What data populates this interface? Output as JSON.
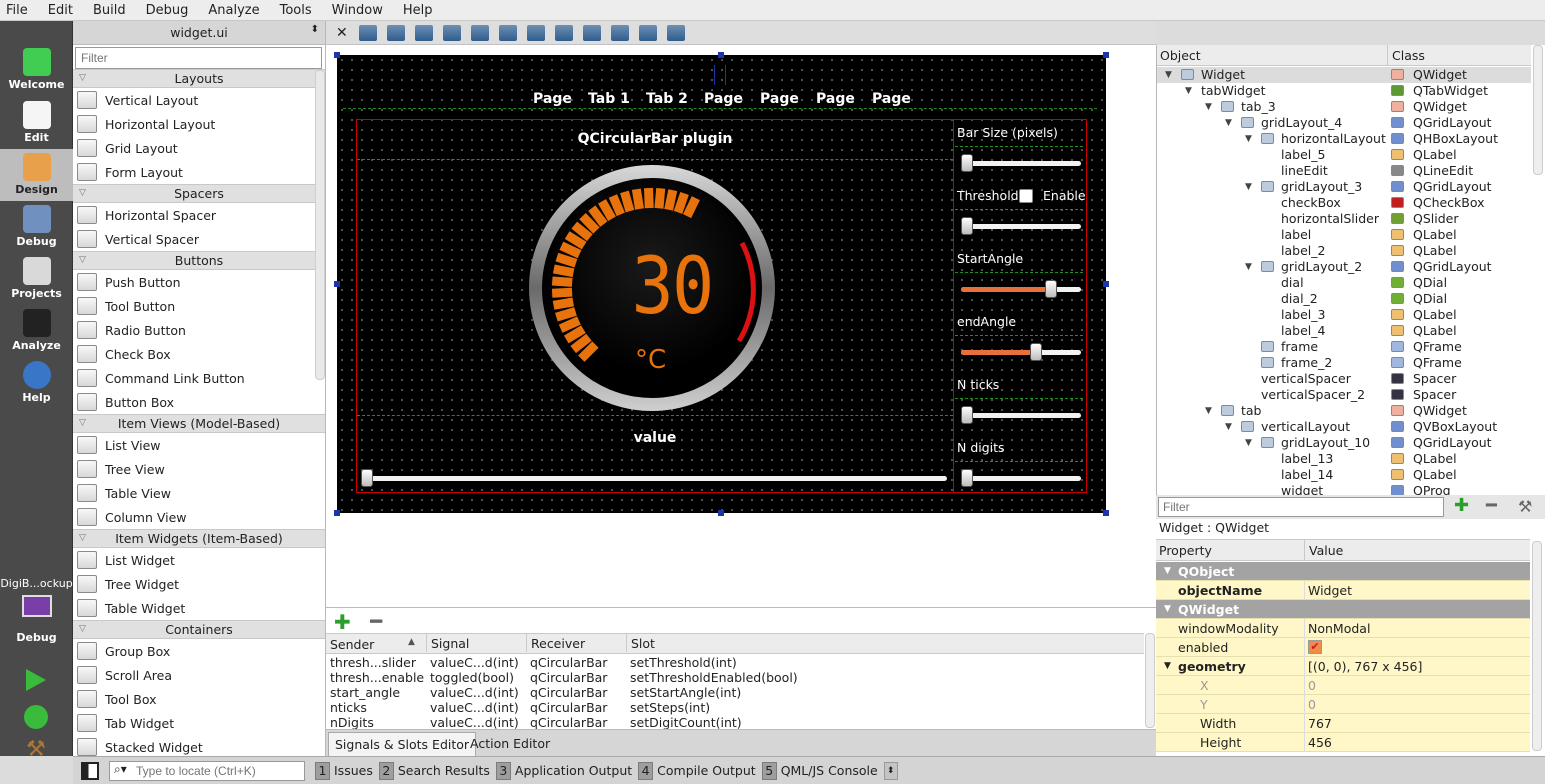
{
  "menu": [
    "File",
    "Edit",
    "Build",
    "Debug",
    "Analyze",
    "Tools",
    "Window",
    "Help"
  ],
  "modes": [
    {
      "label": "Welcome",
      "icon": "qt-logo-icon"
    },
    {
      "label": "Edit",
      "icon": "edit-document-icon"
    },
    {
      "label": "Design",
      "icon": "design-pen-icon"
    },
    {
      "label": "Debug",
      "icon": "debug-bug-icon"
    },
    {
      "label": "Projects",
      "icon": "projects-wrench-icon"
    },
    {
      "label": "Analyze",
      "icon": "analyze-scope-icon"
    },
    {
      "label": "Help",
      "icon": "help-icon"
    }
  ],
  "kit": {
    "name": "DigiB...ockup",
    "mode": "Debug"
  },
  "widget_box": {
    "file": "widget.ui",
    "filter_placeholder": "Filter",
    "categories": [
      {
        "name": "Layouts",
        "items": [
          "Vertical Layout",
          "Horizontal Layout",
          "Grid Layout",
          "Form Layout"
        ]
      },
      {
        "name": "Spacers",
        "items": [
          "Horizontal Spacer",
          "Vertical Spacer"
        ]
      },
      {
        "name": "Buttons",
        "items": [
          "Push Button",
          "Tool Button",
          "Radio Button",
          "Check Box",
          "Command Link Button",
          "Button Box"
        ]
      },
      {
        "name": "Item Views (Model-Based)",
        "items": [
          "List View",
          "Tree View",
          "Table View",
          "Column View"
        ]
      },
      {
        "name": "Item Widgets (Item-Based)",
        "items": [
          "List Widget",
          "Tree Widget",
          "Table Widget"
        ]
      },
      {
        "name": "Containers",
        "items": [
          "Group Box",
          "Scroll Area",
          "Tool Box",
          "Tab Widget",
          "Stacked Widget"
        ]
      }
    ]
  },
  "form": {
    "tabs": [
      "Page",
      "Tab 1",
      "Tab 2",
      "Page",
      "Page",
      "Page",
      "Page"
    ],
    "plugin_title": "QCircularBar plugin",
    "gauge_value": "30",
    "gauge_unit": "°C",
    "value_label": "value",
    "controls": [
      {
        "label": "Bar Size (pixels)",
        "level": 0.0
      },
      {
        "label": "Threshold",
        "check": "Enable",
        "level": 0.0
      },
      {
        "label": "StartAngle",
        "level": 0.78
      },
      {
        "label": "endAngle",
        "level": 0.64
      },
      {
        "label": "N ticks",
        "level": 0.0
      },
      {
        "label": "N digits",
        "level": 0.0
      }
    ],
    "value_slider_level": 0.0
  },
  "signals_slots": {
    "headers": [
      "Sender",
      "Signal",
      "Receiver",
      "Slot"
    ],
    "rows": [
      [
        "thresh...slider",
        "valueC...d(int)",
        "qCircularBar",
        "setThreshold(int)"
      ],
      [
        "thresh...enable",
        "toggled(bool)",
        "qCircularBar",
        "setThresholdEnabled(bool)"
      ],
      [
        "start_angle",
        "valueC...d(int)",
        "qCircularBar",
        "setStartAngle(int)"
      ],
      [
        "nticks",
        "valueC...d(int)",
        "qCircularBar",
        "setSteps(int)"
      ],
      [
        "nDigits",
        "valueC...d(int)",
        "qCircularBar",
        "setDigitCount(int)"
      ]
    ],
    "tabs": [
      "Signals & Slots Editor",
      "Action Editor"
    ]
  },
  "object_inspector": {
    "headers": [
      "Object",
      "Class"
    ],
    "rows": [
      {
        "name": "Widget",
        "cls": "QWidget",
        "depth": 0,
        "exp": "▼"
      },
      {
        "name": "tabWidget",
        "cls": "QTabWidget",
        "depth": 1,
        "exp": "▼"
      },
      {
        "name": "tab_3",
        "cls": "QWidget",
        "depth": 2,
        "exp": "▼"
      },
      {
        "name": "gridLayout_4",
        "cls": "QGridLayout",
        "depth": 3,
        "exp": "▼"
      },
      {
        "name": "horizontalLayout",
        "cls": "QHBoxLayout",
        "depth": 4,
        "exp": "▼"
      },
      {
        "name": "label_5",
        "cls": "QLabel",
        "depth": 5,
        "exp": ""
      },
      {
        "name": "lineEdit",
        "cls": "QLineEdit",
        "depth": 5,
        "exp": ""
      },
      {
        "name": "gridLayout_3",
        "cls": "QGridLayout",
        "depth": 4,
        "exp": "▼"
      },
      {
        "name": "checkBox",
        "cls": "QCheckBox",
        "depth": 5,
        "exp": ""
      },
      {
        "name": "horizontalSlider",
        "cls": "QSlider",
        "depth": 5,
        "exp": ""
      },
      {
        "name": "label",
        "cls": "QLabel",
        "depth": 5,
        "exp": ""
      },
      {
        "name": "label_2",
        "cls": "QLabel",
        "depth": 5,
        "exp": ""
      },
      {
        "name": "gridLayout_2",
        "cls": "QGridLayout",
        "depth": 4,
        "exp": "▼"
      },
      {
        "name": "dial",
        "cls": "QDial",
        "depth": 5,
        "exp": ""
      },
      {
        "name": "dial_2",
        "cls": "QDial",
        "depth": 5,
        "exp": ""
      },
      {
        "name": "label_3",
        "cls": "QLabel",
        "depth": 5,
        "exp": ""
      },
      {
        "name": "label_4",
        "cls": "QLabel",
        "depth": 5,
        "exp": ""
      },
      {
        "name": "frame",
        "cls": "QFrame",
        "depth": 4,
        "exp": ""
      },
      {
        "name": "frame_2",
        "cls": "QFrame",
        "depth": 4,
        "exp": ""
      },
      {
        "name": "verticalSpacer",
        "cls": "Spacer",
        "depth": 4,
        "exp": ""
      },
      {
        "name": "verticalSpacer_2",
        "cls": "Spacer",
        "depth": 4,
        "exp": ""
      },
      {
        "name": "tab",
        "cls": "QWidget",
        "depth": 2,
        "exp": "▼"
      },
      {
        "name": "verticalLayout",
        "cls": "QVBoxLayout",
        "depth": 3,
        "exp": "▼"
      },
      {
        "name": "gridLayout_10",
        "cls": "QGridLayout",
        "depth": 4,
        "exp": "▼"
      },
      {
        "name": "label_13",
        "cls": "QLabel",
        "depth": 5,
        "exp": ""
      },
      {
        "name": "label_14",
        "cls": "QLabel",
        "depth": 5,
        "exp": ""
      },
      {
        "name": "widget",
        "cls": "QProg",
        "depth": 5,
        "exp": ""
      }
    ]
  },
  "property_editor": {
    "filter_placeholder": "Filter",
    "context": "Widget : QWidget",
    "headers": [
      "Property",
      "Value"
    ],
    "rows": [
      {
        "kind": "group",
        "name": "QObject"
      },
      {
        "kind": "prop",
        "name": "objectName",
        "value": "Widget",
        "bold": true
      },
      {
        "kind": "group",
        "name": "QWidget"
      },
      {
        "kind": "prop",
        "name": "windowModality",
        "value": "NonModal"
      },
      {
        "kind": "check",
        "name": "enabled",
        "value": "✔"
      },
      {
        "kind": "prop",
        "name": "geometry",
        "value": "[(0, 0), 767 x 456]",
        "bold": true,
        "exp": "▼"
      },
      {
        "kind": "sub",
        "name": "X",
        "value": "0"
      },
      {
        "kind": "sub",
        "name": "Y",
        "value": "0"
      },
      {
        "kind": "sub2",
        "name": "Width",
        "value": "767"
      },
      {
        "kind": "sub2",
        "name": "Height",
        "value": "456"
      }
    ]
  },
  "status_bar": {
    "locator_placeholder": "Type to locate (Ctrl+K)",
    "panes": [
      {
        "num": "1",
        "label": "Issues"
      },
      {
        "num": "2",
        "label": "Search Results"
      },
      {
        "num": "3",
        "label": "Application Output"
      },
      {
        "num": "4",
        "label": "Compile Output"
      },
      {
        "num": "5",
        "label": "QML/JS Console"
      }
    ]
  },
  "colors": {
    "accent_orange": "#e8730c",
    "threshold_red": "#dd1111",
    "selection_yellow": "#fff7c8",
    "group_header": "#a3a3a3"
  }
}
